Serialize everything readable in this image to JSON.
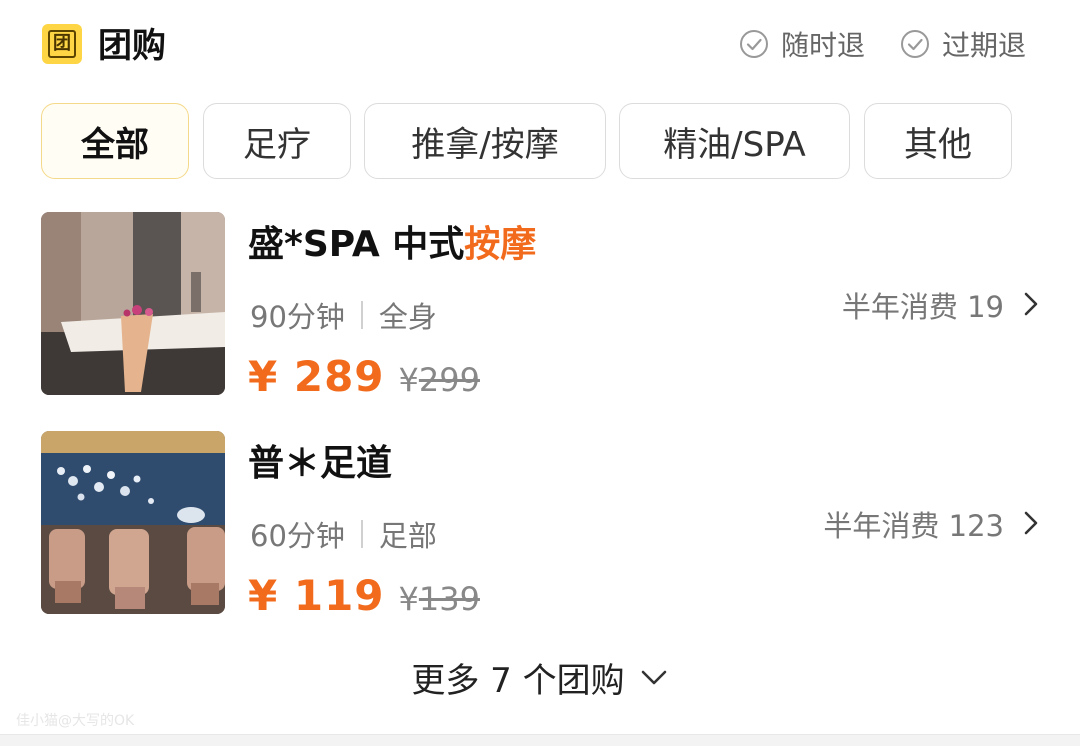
{
  "header": {
    "logo_glyph": "团",
    "title": "团购",
    "guarantees": [
      "随时退",
      "过期退"
    ]
  },
  "tabs": [
    {
      "label": "全部",
      "active": true
    },
    {
      "label": "足疗",
      "active": false
    },
    {
      "label": "推拿/按摩",
      "active": false
    },
    {
      "label": "精油/SPA",
      "active": false
    },
    {
      "label": "其他",
      "active": false
    }
  ],
  "deals": [
    {
      "title_prefix": "盛*SPA 中式",
      "title_highlight": "按摩",
      "duration": "90分钟",
      "scope": "全身",
      "currency": "¥",
      "price": "289",
      "original_price": "299",
      "sales": "半年消费 19"
    },
    {
      "title_prefix": "普＊足道",
      "title_highlight": "",
      "duration": "60分钟",
      "scope": "足部",
      "currency": "¥",
      "price": "119",
      "original_price": "139",
      "sales": "半年消费 123"
    }
  ],
  "more": {
    "label": "更多 7 个团购"
  },
  "watermark": "佳小猫@大写的OK",
  "colors": {
    "accent": "#F26B1D",
    "logo_bg": "#FDD545",
    "active_tab_border": "#F5D98A"
  },
  "icons": [
    "check-circle-icon",
    "chevron-right-icon",
    "chevron-down-icon"
  ]
}
